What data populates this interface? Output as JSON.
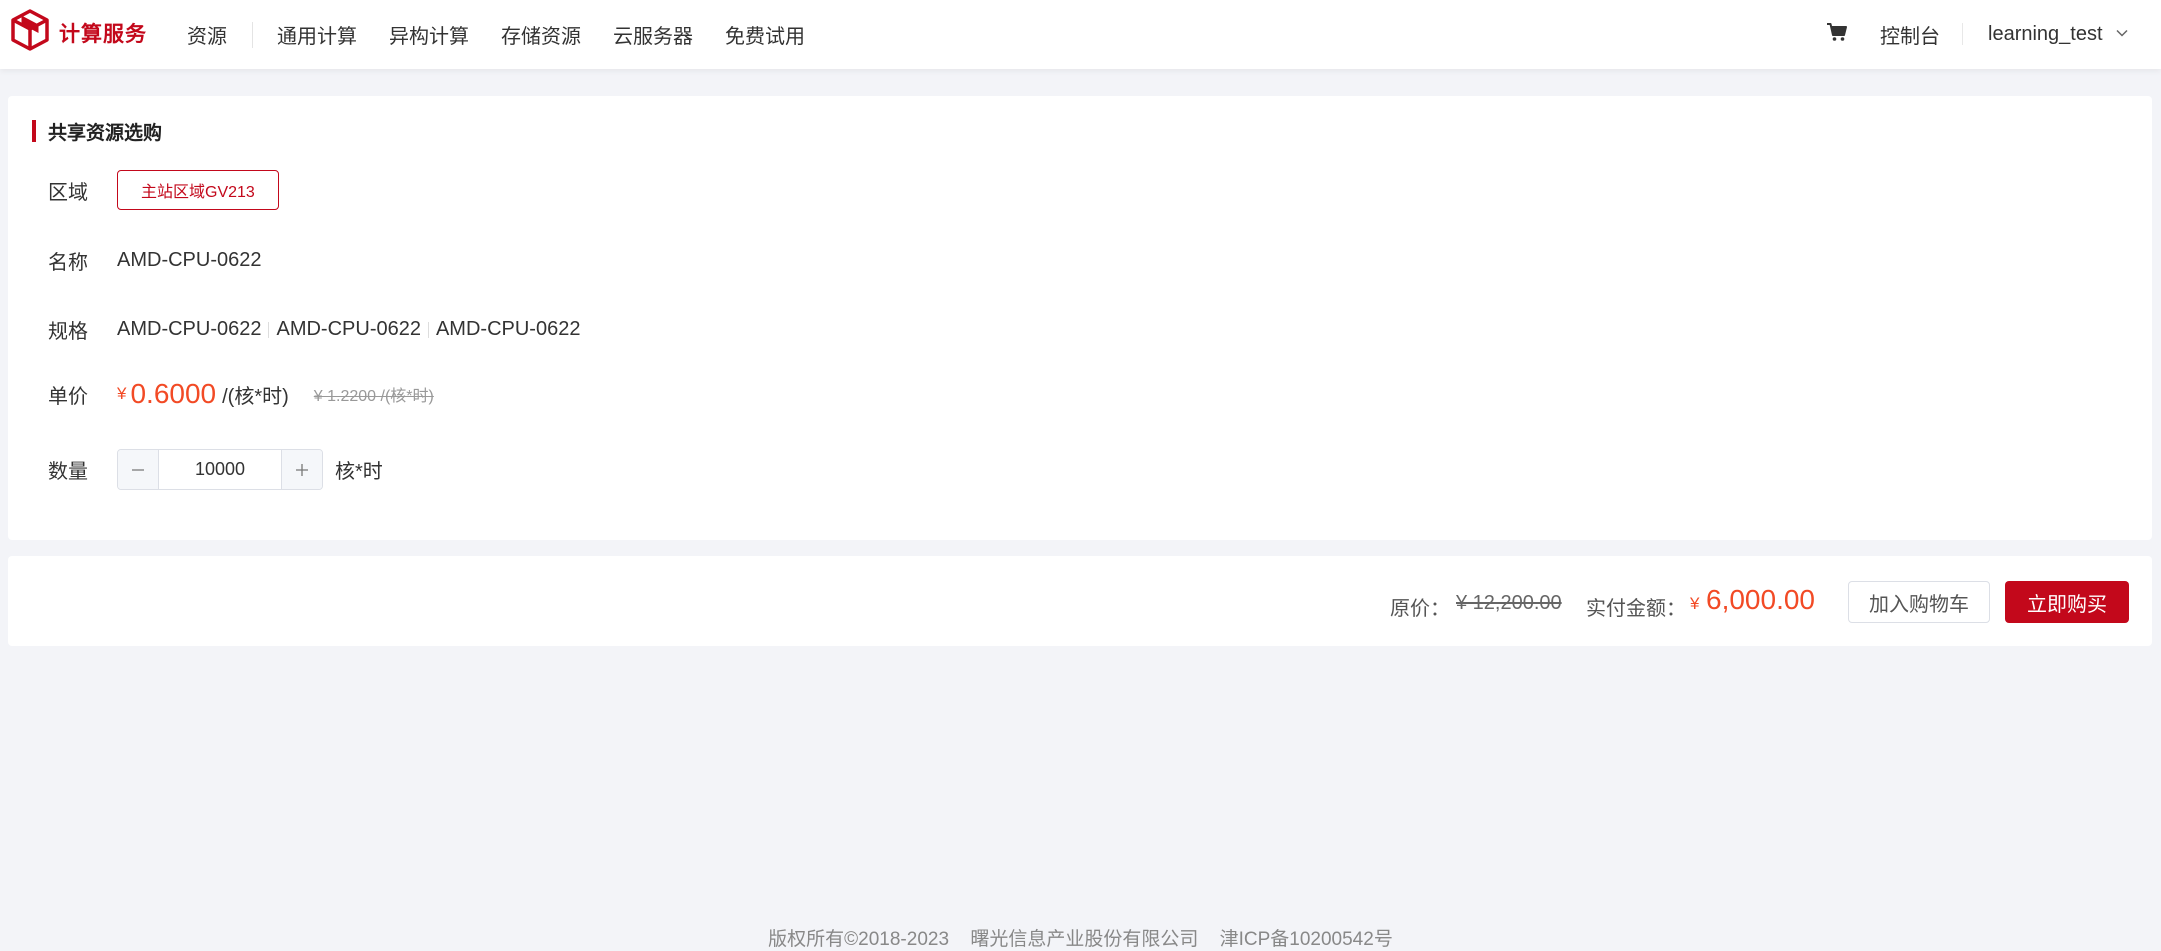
{
  "header": {
    "logo_text": "计算服务",
    "nav": [
      "资源",
      "通用计算",
      "异构计算",
      "存储资源",
      "云服务器",
      "免费试用"
    ],
    "console_label": "控制台",
    "username": "learning_test"
  },
  "purchase": {
    "section_title": "共享资源选购",
    "region_label": "区域",
    "region_value": "主站区域GV213",
    "name_label": "名称",
    "name_value": "AMD-CPU-0622",
    "spec_label": "规格",
    "specs": [
      "AMD-CPU-0622",
      "AMD-CPU-0622",
      "AMD-CPU-0622"
    ],
    "price_label": "单价",
    "price_currency": "¥",
    "price_value": "0.6000",
    "price_unit": "/(核*时)",
    "price_original": "¥ 1.2200 /(核*时)",
    "quantity_label": "数量",
    "quantity_value": "10000",
    "quantity_unit": "核*时"
  },
  "buybar": {
    "original_label": "原价：",
    "original_value": "¥ 12,200.00",
    "pay_label": "实付金额：",
    "pay_currency": "¥",
    "pay_value": "6,000.00",
    "add_to_cart": "加入购物车",
    "buy_now": "立即购买"
  },
  "footer": {
    "copyright": "版权所有©2018-2023",
    "company": "曙光信息产业股份有限公司",
    "icp": "津ICP备10200542号"
  },
  "icons": [
    "logo-cube-icon",
    "cart-icon",
    "chevron-down-icon"
  ],
  "colors": {
    "brand": "#c3081b",
    "price": "#f24a25",
    "background": "#f3f4f8"
  }
}
